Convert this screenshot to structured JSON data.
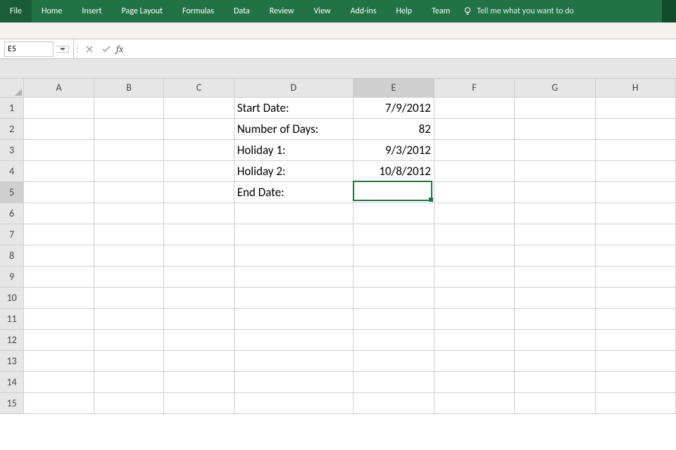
{
  "ribbon": {
    "tabs": [
      "File",
      "Home",
      "Insert",
      "Page Layout",
      "Formulas",
      "Data",
      "Review",
      "View",
      "Add-ins",
      "Help",
      "Team"
    ],
    "tellme": "Tell me what you want to do"
  },
  "namebox": {
    "value": "E5"
  },
  "fx_label": "fx",
  "formula": "",
  "columns": [
    "A",
    "B",
    "C",
    "D",
    "E",
    "F",
    "G",
    "H"
  ],
  "rows": [
    "1",
    "2",
    "3",
    "4",
    "5",
    "6",
    "7",
    "8",
    "9",
    "10",
    "11",
    "12",
    "13",
    "14",
    "15"
  ],
  "active": {
    "col": "E",
    "row": "5"
  },
  "cells": {
    "D1": "Start Date:",
    "E1": "7/9/2012",
    "D2": "Number of Days:",
    "E2": "82",
    "D3": "Holiday 1:",
    "E3": "9/3/2012",
    "D4": "Holiday 2:",
    "E4": "10/8/2012",
    "D5": "End Date:",
    "E5": ""
  }
}
